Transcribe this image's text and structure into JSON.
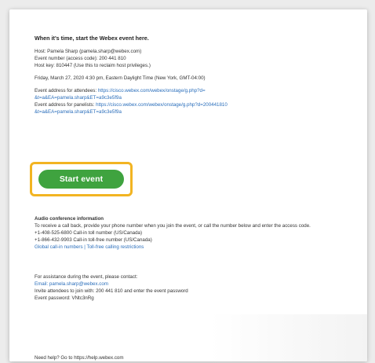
{
  "email": {
    "heading": "When it's time, start the Webex event here.",
    "host_lines": [
      "Host: Pamela Sharp (pamela.sharp@webex.com)",
      "Event number (access code): 200 441 810",
      "Host key: 810447 (Use this to reclaim host privileges.)"
    ],
    "date_line": "Friday, March 27, 2020 4:30 pm, Eastern Daylight Time (New York, GMT-04:00)",
    "attendee_link_label": "Event address for attendees:",
    "attendee_link_url": "https://cisco.webex.com/webex/onstage/g.php?d=",
    "attendee_link_url2": "&t=a&EA=pamela.sharp&ET=a9c3e5f9a",
    "panelist_link_label": "Event address for panelists:",
    "panelist_link_url": "https://cisco.webex.com/webex/onstage/g.php?d=200441810",
    "panelist_link_url2": "&t=a&EA=pamela.sharp&ET=a9c3e5f9a",
    "start_button_label": "Start event",
    "audio_heading": "Audio conference information",
    "audio_lines": [
      "To receive a call back, provide your phone number when you join the event, or call the number below and enter the access code.",
      "+1-408-525-6800 Call-in toll number (US/Canada)",
      "+1-866-432-9903 Call-in toll-free number (US/Canada)"
    ],
    "global_numbers_link": "Global call-in numbers | Toll-free calling restrictions",
    "support_lines": [
      "For assistance during the event, please contact:",
      "Email: pamela.sharp@webex.com"
    ],
    "support_extra": [
      "Invite attendees to join with: 200 441 810 and enter the event password",
      "Event password: VNtc3nRg"
    ],
    "footer": "Need help? Go to https://help.webex.com"
  }
}
